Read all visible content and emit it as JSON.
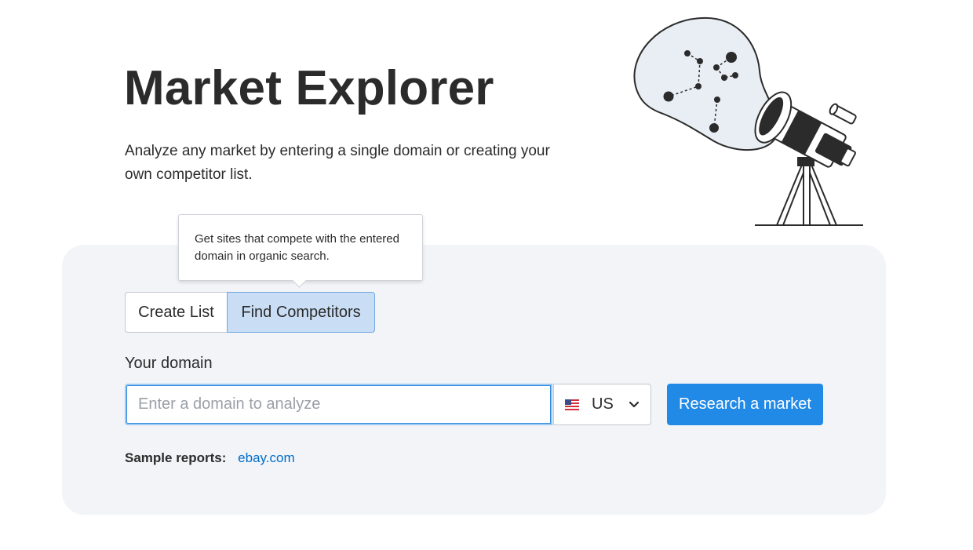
{
  "header": {
    "title": "Market Explorer",
    "subtitle": "Analyze any market by entering a single domain or creating your own competitor list."
  },
  "illustration": {
    "icon": "telescope-icon"
  },
  "tooltip": {
    "text": "Get sites that compete with the entered domain in organic search."
  },
  "tabs": [
    {
      "label": "Create List",
      "active": false
    },
    {
      "label": "Find Competitors",
      "active": true
    }
  ],
  "form": {
    "domain_label": "Your domain",
    "domain_placeholder": "Enter a domain to analyze",
    "domain_value": "",
    "database": {
      "code": "US",
      "flag": "us-flag-icon"
    },
    "submit_label": "Research a market"
  },
  "samples": {
    "label": "Sample reports:",
    "links": [
      "ebay.com"
    ]
  },
  "colors": {
    "accent": "#2189e6",
    "tab_active_bg": "#c9def4",
    "panel_bg": "#f2f4f7",
    "link": "#006dca"
  }
}
